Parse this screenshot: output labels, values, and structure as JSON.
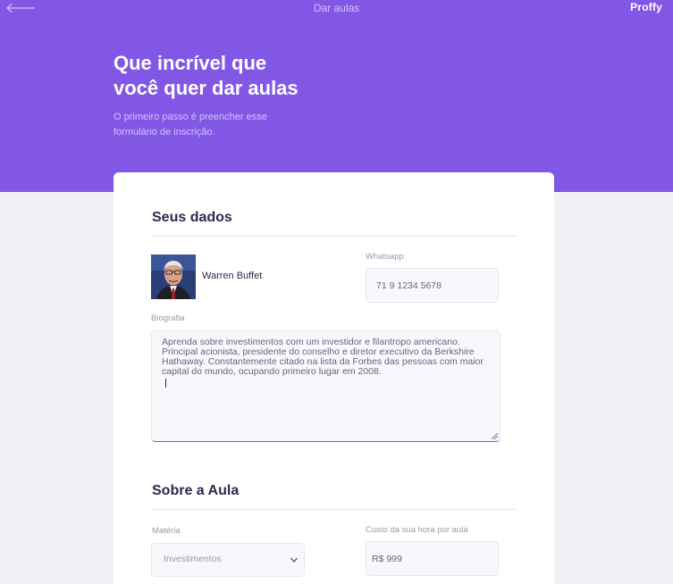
{
  "topbar": {
    "title": "Dar aulas",
    "logo": "Proffy",
    "back_icon": "arrow-left-icon"
  },
  "hero": {
    "title_line1": "Que incrível que",
    "title_line2": "você quer dar aulas",
    "subtitle_line1": "O primeiro passo é preencher esse",
    "subtitle_line2": "formulário de inscrição."
  },
  "seus_dados": {
    "title": "Seus dados",
    "name": "Warren Buffet",
    "whatsapp_label": "Whatsapp",
    "whatsapp_value": "71 9 1234 5678",
    "bio_label": "Biografia",
    "bio_lines": [
      "Aprenda sobre investimentos com um investidor e filantropo americano.",
      "Principal acionista, presidente do conselho e diretor executivo da Berkshire",
      "Hathaway. Constantemente citado na lista da Forbes das pessoas com maior",
      "capital do mundo, ocupando primeiro lugar em 2008."
    ]
  },
  "sobre_aula": {
    "title": "Sobre a Aula",
    "materia_label": "Matéria",
    "materia_value": "Investimentos",
    "custo_label": "Custo da sua hora por aula",
    "custo_value": "R$ 999"
  },
  "colors": {
    "primary": "#8257E5",
    "background": "#F0F0F7",
    "card": "#FFFFFF",
    "title_text": "#32264D"
  }
}
